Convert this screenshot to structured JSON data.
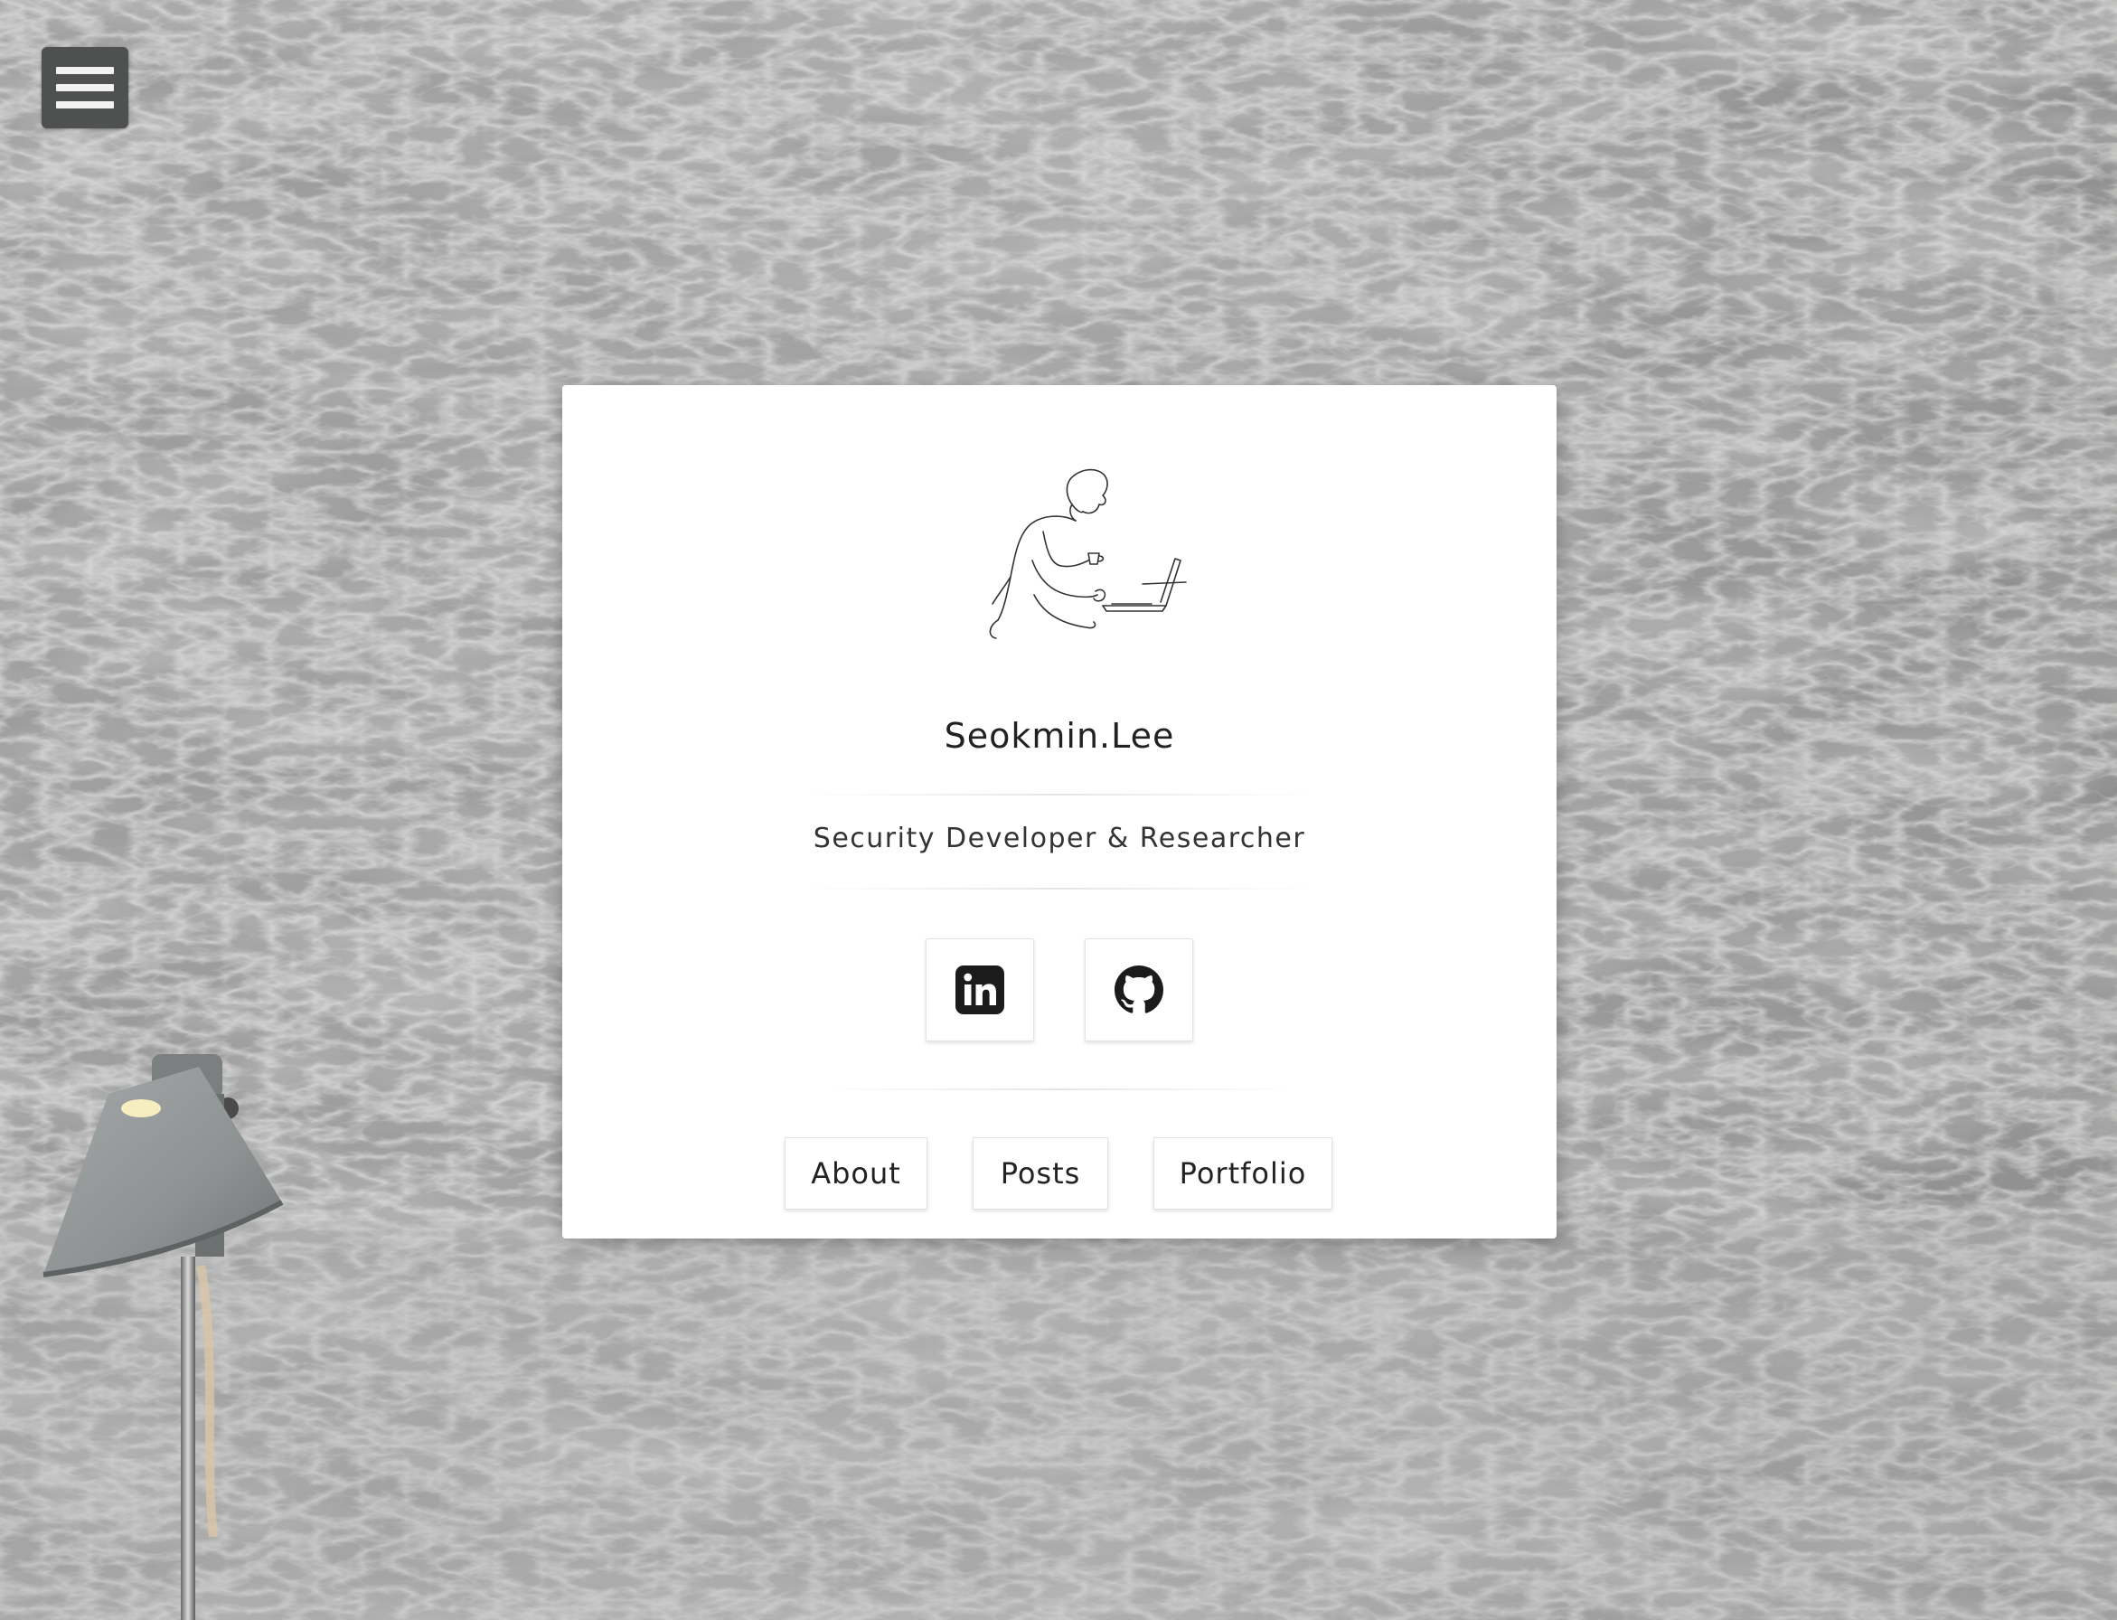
{
  "menu": {
    "icon": "hamburger-menu-icon"
  },
  "profile": {
    "name": "Seokmin.Lee",
    "tagline": "Security Developer & Researcher",
    "avatar_icon": "person-with-laptop-line-drawing"
  },
  "social": [
    {
      "icon": "linkedin-icon"
    },
    {
      "icon": "github-icon"
    }
  ],
  "nav": {
    "about_label": "About",
    "posts_label": "Posts",
    "portfolio_label": "Portfolio"
  },
  "colors": {
    "background": "#8a8c8b",
    "card": "#ffffff",
    "menu_button": "#4f5050",
    "text": "#222222"
  }
}
